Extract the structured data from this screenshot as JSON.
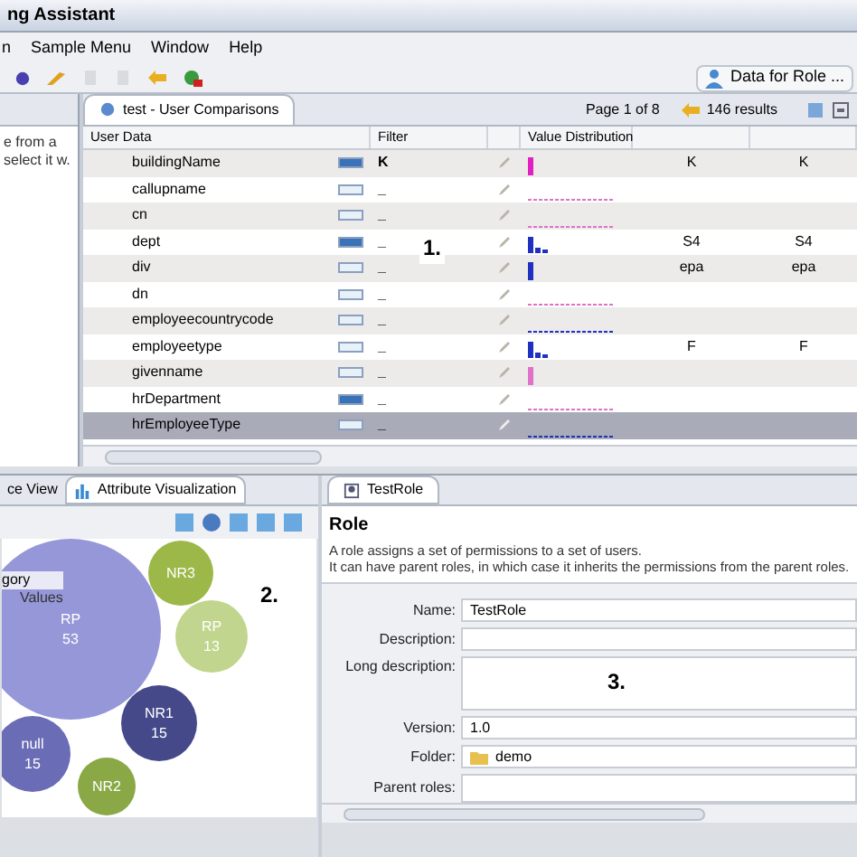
{
  "window": {
    "title": "ng Assistant"
  },
  "menu": [
    "n",
    "Sample Menu",
    "Window",
    "Help"
  ],
  "toolbar": {
    "perspective": "Data for Role ..."
  },
  "left_panel": {
    "text": "e from a select it w."
  },
  "editor": {
    "tab": "test - User Comparisons",
    "page": "Page 1 of 8",
    "results": "146 results",
    "columns": [
      "User Data",
      "Filter",
      "",
      "Value Distribution"
    ],
    "rows": [
      {
        "name": "buildingName",
        "filter_active": true,
        "filter": "K",
        "selected": false,
        "color": "#e020c0",
        "values": [
          "K",
          "K"
        ]
      },
      {
        "name": "callupname",
        "filter_active": false,
        "filter": "_",
        "selected": false,
        "color": "#e070c8",
        "values": []
      },
      {
        "name": "cn",
        "filter_active": false,
        "filter": "_",
        "selected": false,
        "color": "#e070c8",
        "values": []
      },
      {
        "name": "dept",
        "filter_active": true,
        "filter": "_",
        "selected": false,
        "color": "#2030c0",
        "values": [
          "S4",
          "S4"
        ]
      },
      {
        "name": "div",
        "filter_active": false,
        "filter": "_",
        "selected": false,
        "color": "#2030c0",
        "values": [
          "epa",
          "epa"
        ]
      },
      {
        "name": "dn",
        "filter_active": false,
        "filter": "_",
        "selected": false,
        "color": "#e070c8",
        "values": []
      },
      {
        "name": "employeecountrycode",
        "filter_active": false,
        "filter": "_",
        "selected": false,
        "color": "#2030c0",
        "values": []
      },
      {
        "name": "employeetype",
        "filter_active": false,
        "filter": "_",
        "selected": false,
        "color": "#2030c0",
        "values": [
          "F",
          "F"
        ]
      },
      {
        "name": "givenname",
        "filter_active": false,
        "filter": "_",
        "selected": false,
        "color": "#e070c8",
        "values": []
      },
      {
        "name": "hrDepartment",
        "filter_active": true,
        "filter": "_",
        "selected": false,
        "color": "#e070c8",
        "values": []
      },
      {
        "name": "hrEmployeeType",
        "filter_active": false,
        "filter": "_",
        "selected": true,
        "color": "#2030c0",
        "values": []
      }
    ]
  },
  "visualization": {
    "tabs": [
      {
        "label": "ce View",
        "selected": false
      },
      {
        "label": "Attribute Visualization",
        "selected": true
      }
    ],
    "legend": [
      "gory",
      "Values"
    ],
    "bubbles": [
      {
        "label": "RP",
        "count": "53",
        "color": "#9597d8"
      },
      {
        "label": "NR3",
        "color": "#9cb848"
      },
      {
        "label": "RP",
        "count": "13",
        "color": "#c2d58e"
      },
      {
        "label": "NR1",
        "count": "15",
        "color": "#45498a"
      },
      {
        "label": "null",
        "count": "15",
        "color": "#6a6cb5"
      },
      {
        "label": "NR2",
        "color": "#8aa845"
      }
    ]
  },
  "role_editor": {
    "tab": "TestRole",
    "heading": "Role",
    "description": [
      "A role assigns a set of permissions to a set of users.",
      "It can have parent roles, in which case it inherits the permissions from the parent roles."
    ],
    "fields": [
      {
        "label": "Name:",
        "kind": "text",
        "value": "TestRole"
      },
      {
        "label": "Description:",
        "kind": "text"
      },
      {
        "label": "Long description:",
        "kind": "textarea"
      },
      {
        "label": "Version:",
        "kind": "text",
        "value": "1.0"
      },
      {
        "label": "Folder:",
        "kind": "folder",
        "value": "demo"
      },
      {
        "label": "Parent roles:",
        "kind": "list"
      }
    ]
  },
  "annotations": [
    "1.",
    "2.",
    "3."
  ]
}
